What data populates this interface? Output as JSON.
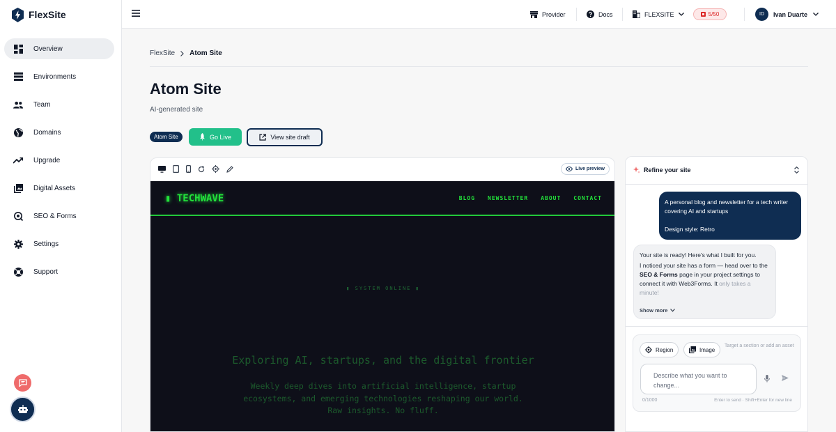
{
  "app": {
    "name": "FlexSite"
  },
  "sidebar": {
    "items": [
      {
        "label": "Overview",
        "icon": "dashboard-icon",
        "active": true
      },
      {
        "label": "Environments",
        "icon": "server-icon"
      },
      {
        "label": "Team",
        "icon": "team-icon"
      },
      {
        "label": "Domains",
        "icon": "globe-icon"
      },
      {
        "label": "Upgrade",
        "icon": "trending-up-icon"
      },
      {
        "label": "Digital Assets",
        "icon": "image-library-icon"
      },
      {
        "label": "SEO & Forms",
        "icon": "seo-search-icon"
      },
      {
        "label": "Settings",
        "icon": "gear-icon"
      },
      {
        "label": "Support",
        "icon": "lifebuoy-icon"
      }
    ]
  },
  "topbar": {
    "provider_label": "Provider",
    "docs_label": "Docs",
    "org_label": "FLEXSITE",
    "quota_label": "5/50",
    "user_initials": "ID",
    "user_name": "Ivan Duarte"
  },
  "breadcrumb": {
    "root": "FlexSite",
    "current": "Atom Site"
  },
  "page": {
    "title": "Atom Site",
    "subtitle": "AI-generated site",
    "badge": "Atom Site",
    "go_live_label": "Go Live",
    "view_draft_label": "View site draft"
  },
  "preview": {
    "live_label": "Live preview",
    "site": {
      "logo": "▮ TECHWAVE",
      "nav": [
        "BLOG",
        "NEWSLETTER",
        "ABOUT",
        "CONTACT"
      ],
      "status": "▮ SYSTEM ONLINE ▮",
      "headline": "Exploring AI, startups, and the digital frontier",
      "sub_line1": "Weekly deep dives into artificial intelligence, startup",
      "sub_line2": "ecosystems, and emerging technologies reshaping our world.",
      "sub_line3": "Raw insights. No fluff."
    }
  },
  "refine": {
    "title": "Refine your site",
    "user_msg_line1": "A personal blog and newsletter for a tech writer covering AI and startups",
    "user_msg_line2": "Design style: Retro",
    "bot_msg_ready": "Your site is ready! Here's what I built for you.",
    "bot_msg_a": "I noticed your site has a form — head over to the ",
    "bot_msg_bold": "SEO & Forms",
    "bot_msg_b": " page in your project settings to connect it with Web3Forms. It ",
    "bot_msg_fade": "only takes a minute!",
    "show_more": "Show more",
    "region_label": "Region",
    "image_label": "Image",
    "hint": "Target a section or add an asset",
    "input_placeholder": "Describe what you want to change...",
    "char_count": "0/1000",
    "enter_hint": "Enter to send · Shift+Enter for new line"
  },
  "colors": {
    "brand": "#0f2d52",
    "accent_green": "#22c08a",
    "retro_green": "#22e13a",
    "quota_red": "#dc2626"
  }
}
